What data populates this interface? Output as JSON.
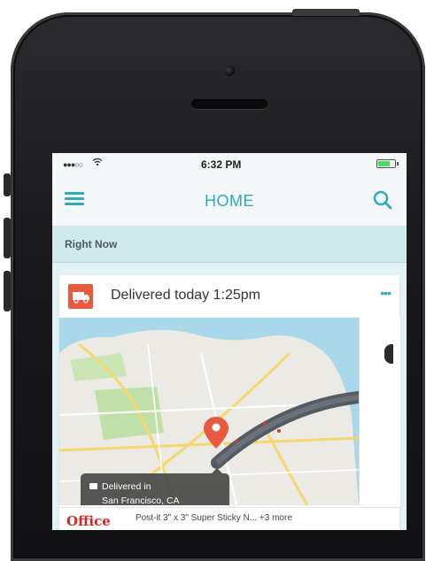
{
  "status_bar": {
    "time": "6:32 PM",
    "signal": "●●●○○",
    "wifi_icon": "wifi-icon",
    "battery_level": 0.7
  },
  "nav": {
    "title": "HOME",
    "menu_icon": "hamburger-menu-icon",
    "search_icon": "search-icon"
  },
  "section": {
    "title": "Right Now"
  },
  "card": {
    "title": "Delivered today 1:25pm",
    "icon": "delivery-truck-icon",
    "more_icon": "more-dots-icon",
    "accent": "#e9593e"
  },
  "map": {
    "pin_icon": "location-pin-icon",
    "tooltip": {
      "line1": "Delivered in",
      "line2": "San Francisco, CA",
      "icon": "package-icon"
    }
  },
  "item": {
    "store": "Office",
    "description": "Post-it 3\" x 3\" Super Sticky N... +3 more"
  },
  "colors": {
    "brand": "#2ea9bd",
    "pin": "#e9593e",
    "store": "#d0261f"
  }
}
